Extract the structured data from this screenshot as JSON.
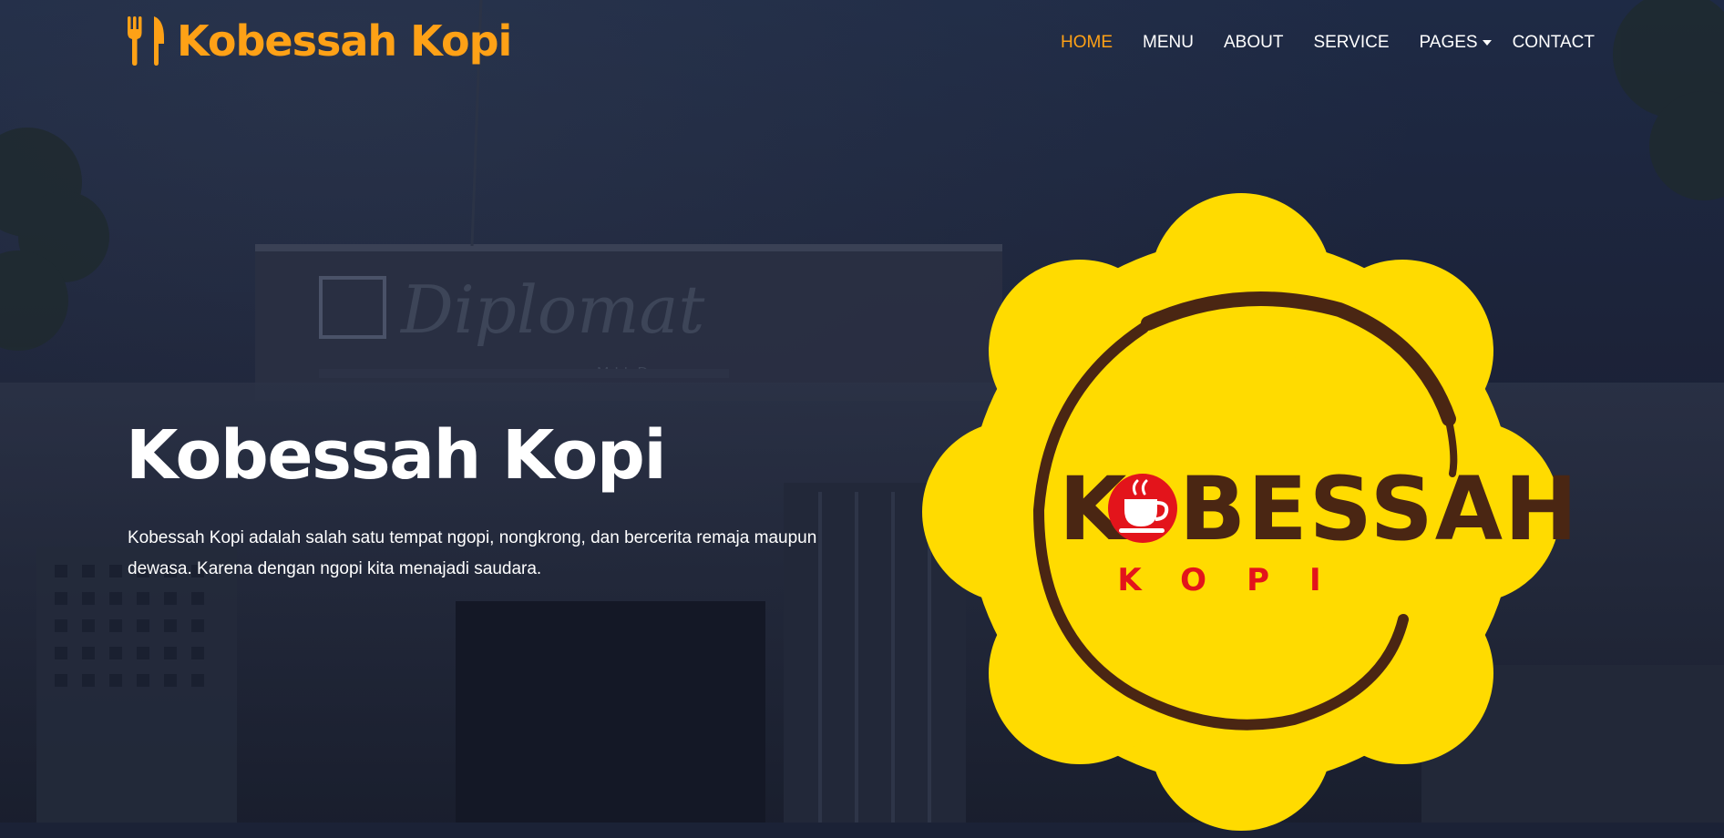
{
  "brand": {
    "name": "Kobessah Kopi",
    "icon": "utensils-icon",
    "color": "#FEA116"
  },
  "nav": {
    "items": [
      {
        "label": "HOME",
        "active": true
      },
      {
        "label": "MENU"
      },
      {
        "label": "ABOUT"
      },
      {
        "label": "SERVICE"
      },
      {
        "label": "PAGES",
        "has_dropdown": true
      },
      {
        "label": "CONTACT"
      }
    ]
  },
  "hero": {
    "title": "Kobessah Kopi",
    "description": "Kobessah Kopi adalah salah satu tempat ngopi, nongkrong, dan bercerita remaja maupun dewasa. Karena dengan ngopi kita menajadi saudara."
  },
  "logo": {
    "word": "KOBESSAH",
    "sub": "KOPI",
    "badge_color": "#FFDB00",
    "ink_color": "#4a2613",
    "accent_color": "#E3141B"
  },
  "background": {
    "sign_text": "Diplomat",
    "sign_sub": "MILD"
  }
}
